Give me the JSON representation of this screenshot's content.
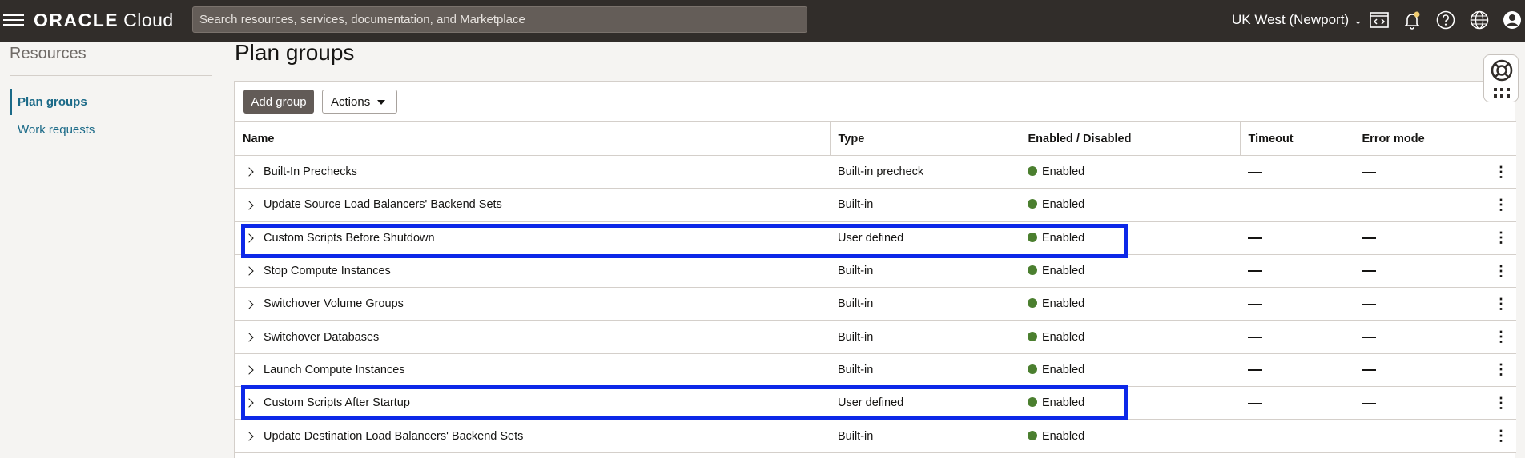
{
  "header": {
    "brand": "ORACLE",
    "brand_suffix": "Cloud",
    "search_placeholder": "Search resources, services, documentation, and Marketplace",
    "region": "UK West (Newport)",
    "icons": [
      "code-editor-icon",
      "bell-icon",
      "help-icon",
      "globe-icon",
      "user-icon"
    ]
  },
  "sidebar": {
    "title": "Resources",
    "items": [
      {
        "label": "Plan groups",
        "active": true
      },
      {
        "label": "Work requests",
        "active": false
      }
    ]
  },
  "main": {
    "title": "Plan groups",
    "toolbar": {
      "add_label": "Add group",
      "actions_label": "Actions"
    },
    "columns": [
      "Name",
      "Type",
      "Enabled / Disabled",
      "Timeout",
      "Error mode"
    ],
    "rows": [
      {
        "name": "Built-In Prechecks",
        "type": "Built-in precheck",
        "status": "Enabled"
      },
      {
        "name": "Update Source Load Balancers' Backend Sets",
        "type": "Built-in",
        "status": "Enabled"
      },
      {
        "name": "Custom Scripts Before Shutdown",
        "type": "User defined",
        "status": "Enabled"
      },
      {
        "name": "Stop Compute Instances",
        "type": "Built-in",
        "status": "Enabled"
      },
      {
        "name": "Switchover Volume Groups",
        "type": "Built-in",
        "status": "Enabled"
      },
      {
        "name": "Switchover Databases",
        "type": "Built-in",
        "status": "Enabled"
      },
      {
        "name": "Launch Compute Instances",
        "type": "Built-in",
        "status": "Enabled"
      },
      {
        "name": "Custom Scripts After Startup",
        "type": "User defined",
        "status": "Enabled"
      },
      {
        "name": "Update Destination Load Balancers' Backend Sets",
        "type": "Built-in",
        "status": "Enabled"
      }
    ]
  },
  "colors": {
    "header_bg": "#312d2a",
    "link": "#1b6a88",
    "enabled_dot": "#4b7f2f",
    "highlight": "#0d28e8"
  }
}
